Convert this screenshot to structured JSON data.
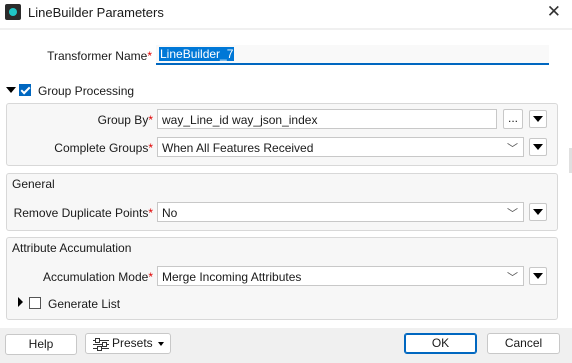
{
  "window": {
    "title": "LineBuilder Parameters",
    "close_glyph": "✕",
    "icon": "fme-transformer-icon"
  },
  "transformer_name": {
    "label": "Transformer Name",
    "required": "*",
    "value": "LineBuilder_7"
  },
  "group_processing": {
    "label": "Group Processing",
    "checked": true,
    "group_by": {
      "label": "Group By",
      "required": "*",
      "value": "way_Line_id way_json_index",
      "browse_label": "..."
    },
    "complete_groups": {
      "label": "Complete Groups",
      "required": "*",
      "value": "When All Features Received"
    }
  },
  "general": {
    "title": "General",
    "remove_duplicate_points": {
      "label": "Remove Duplicate Points",
      "required": "*",
      "value": "No"
    }
  },
  "attribute_accumulation": {
    "title": "Attribute Accumulation",
    "accumulation_mode": {
      "label": "Accumulation Mode",
      "required": "*",
      "value": "Merge Incoming Attributes"
    },
    "generate_list": {
      "label": "Generate List",
      "checked": false
    }
  },
  "footer": {
    "help": "Help",
    "presets": "Presets",
    "ok": "OK",
    "cancel": "Cancel"
  },
  "colors": {
    "accent": "#0067c0",
    "selection": "#0078d7",
    "required": "#e00000"
  }
}
